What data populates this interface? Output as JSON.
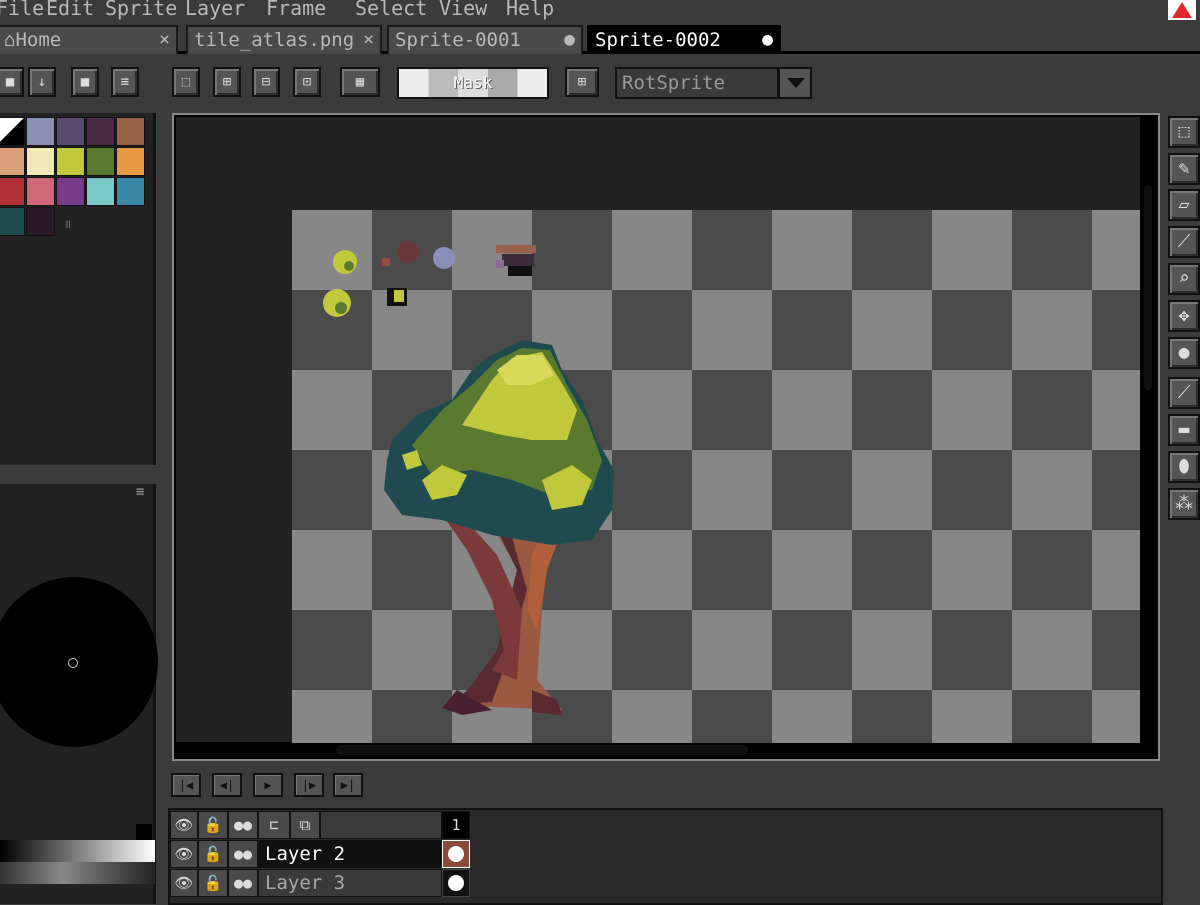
{
  "menu": {
    "file": "File",
    "edit": "Edit",
    "sprite": "Sprite",
    "layer": "Layer",
    "frame": "Frame",
    "select": "Select",
    "view": "View",
    "help": "Help"
  },
  "tabs": [
    {
      "label": "Home",
      "close": "×"
    },
    {
      "label": "tile_atlas.png",
      "close": "×"
    },
    {
      "label": "Sprite-0001",
      "close": "●"
    },
    {
      "label": "Sprite-0002",
      "close": "●"
    }
  ],
  "toolbar": {
    "mask_label": "Mask",
    "rotation_algorithm": "RotSprite"
  },
  "palette": {
    "colors": [
      "#8a8fb8",
      "#5a4a6e",
      "#4a2a44",
      "#9a6248",
      "#d9a07a",
      "#f2e9b8",
      "#c2c83c",
      "#5a7a30",
      "#e89a40",
      "#b0303a",
      "#d06878",
      "#7a3a8a",
      "#7ac8c8",
      "#3a88a8",
      "#1e4a50",
      "#2a1a28"
    ]
  },
  "timeline": {
    "frame_number": "1",
    "layers": [
      {
        "name": "Layer 2",
        "active": true
      },
      {
        "name": "Layer 3",
        "active": false
      }
    ]
  },
  "colors": {
    "accent": "#e2242b",
    "canvas_dark": "#4b4b4b",
    "canvas_light": "#878787"
  }
}
